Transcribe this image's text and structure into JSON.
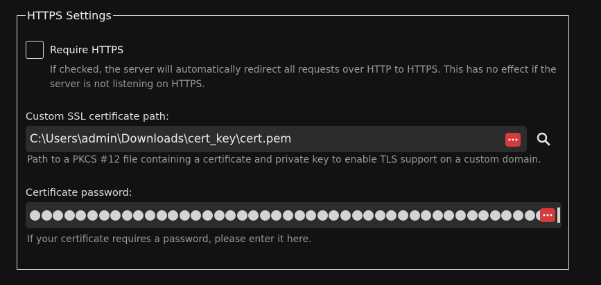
{
  "section": {
    "legend": "HTTPS Settings"
  },
  "require_https": {
    "label": "Require HTTPS",
    "checked": false,
    "hint_line1": "If checked, the server will automatically redirect all requests over HTTP to HTTPS. This has no effect if the",
    "hint_line2": "server is not listening on HTTPS."
  },
  "cert_path": {
    "label": "Custom SSL certificate path:",
    "value": "C:\\Users\\admin\\Downloads\\cert_key\\cert.pem",
    "hint": "Path to a PKCS #12 file containing a certificate and private key to enable TLS support on a custom domain.",
    "password_manager_icon": "password-manager-icon",
    "browse_icon": "search-icon"
  },
  "cert_password": {
    "label": "Certificate password:",
    "masked": true,
    "hint": "If your certificate requires a password, please enter it here.",
    "password_manager_icon": "password-manager-icon"
  },
  "colors": {
    "background": "#121212",
    "input_background": "#2c2c2c",
    "password_manager_accent": "#d63b3b",
    "hint_text": "#9a9a9a"
  }
}
